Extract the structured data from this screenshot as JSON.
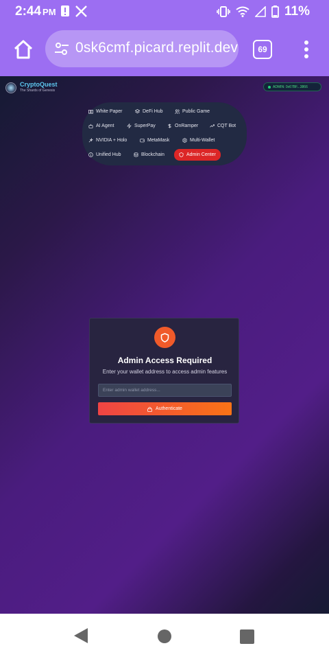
{
  "status_bar": {
    "time": "2:44",
    "ampm": "PM",
    "battery_percent": "11%",
    "icons": [
      "alert-icon",
      "x-logo-icon",
      "vibrate-icon",
      "wifi-icon",
      "signal-icon",
      "battery-icon"
    ]
  },
  "browser": {
    "url": "0sk6cmf.picard.replit.dev",
    "tab_count": "69",
    "icons": [
      "home-icon",
      "tune-icon",
      "tabs-icon",
      "more-vert-icon"
    ]
  },
  "site": {
    "brand_name": "CryptoQuest",
    "brand_subtitle": "The Shards of Genesis",
    "admin_badge": "ADMIN: 0x67BF...3866"
  },
  "nav": {
    "items": [
      {
        "label": "White Paper",
        "icon": "book-icon"
      },
      {
        "label": "DeFi Hub",
        "icon": "layers-icon"
      },
      {
        "label": "Public Game",
        "icon": "users-icon"
      },
      {
        "label": "AI Agent",
        "icon": "bot-icon"
      },
      {
        "label": "SuperPay",
        "icon": "zap-icon"
      },
      {
        "label": "OnRamper",
        "icon": "dollar-icon"
      },
      {
        "label": "CQT Bot",
        "icon": "trending-icon"
      },
      {
        "label": "NVIDIA + Holo",
        "icon": "sparkles-icon"
      },
      {
        "label": "MetaMask",
        "icon": "wallet-icon"
      },
      {
        "label": "Multi-Wallet",
        "icon": "hexagon-icon"
      },
      {
        "label": "Unified Hub",
        "icon": "info-icon"
      },
      {
        "label": "Blockchain",
        "icon": "database-icon"
      },
      {
        "label": "Admin Center",
        "icon": "shield-icon",
        "active": true
      }
    ]
  },
  "admin_card": {
    "title": "Admin Access Required",
    "subtitle": "Enter your wallet address to access admin features",
    "input_placeholder": "Enter admin wallet address...",
    "input_value": "",
    "button_label": "Authenticate"
  },
  "colors": {
    "status_bar": "#9c6ef2",
    "accent_red": "#dc2626",
    "accent_orange": "#f97316",
    "admin_green": "#4ade80",
    "brand_blue": "#5ec8f0"
  }
}
